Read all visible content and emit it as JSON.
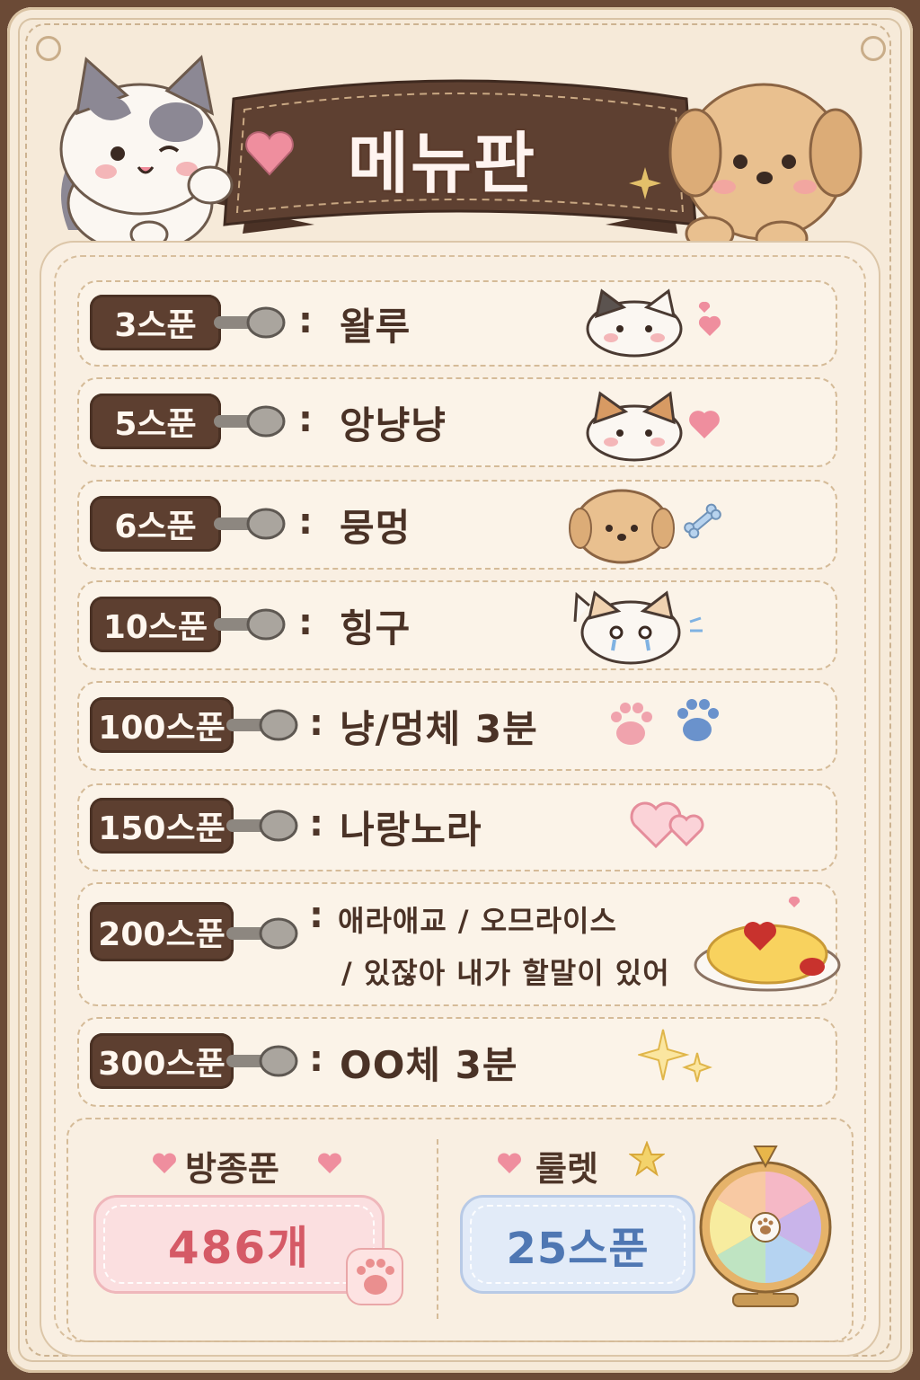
{
  "title": "메뉴판",
  "menu": [
    {
      "spoons": "3스푼",
      "name": "왈루",
      "deco": "cat-wink-icon"
    },
    {
      "spoons": "5스푼",
      "name": "앙냥냥",
      "deco": "cat-smile-icon"
    },
    {
      "spoons": "6스푼",
      "name": "뭉멍",
      "deco": "puppy-icon"
    },
    {
      "spoons": "10스푼",
      "name": "힝구",
      "deco": "cat-crying-icon"
    },
    {
      "spoons": "100스푼",
      "name": "냥/멍체 3분",
      "deco": "paw-prints-icon"
    },
    {
      "spoons": "150스푼",
      "name": "나랑노라",
      "deco": "hearts-icon"
    },
    {
      "spoons": "200스푼",
      "name_line1": "애라애교 / 오므라이스",
      "name_line2": "/ 있잖아 내가 할말이 있어",
      "deco": "omurice-icon"
    },
    {
      "spoons": "300스푼",
      "name": "OO체 3분",
      "deco": "sparkles-icon"
    }
  ],
  "separator": ":",
  "bottom": {
    "broadcast_label": "방종푼",
    "broadcast_value": "486개",
    "roulette_label": "룰렛",
    "roulette_value": "25스푼"
  },
  "colors": {
    "tag": "#5d3f30",
    "background": "#f6ead9",
    "pink_value": "#d55a66",
    "blue_value": "#4f77b3"
  }
}
